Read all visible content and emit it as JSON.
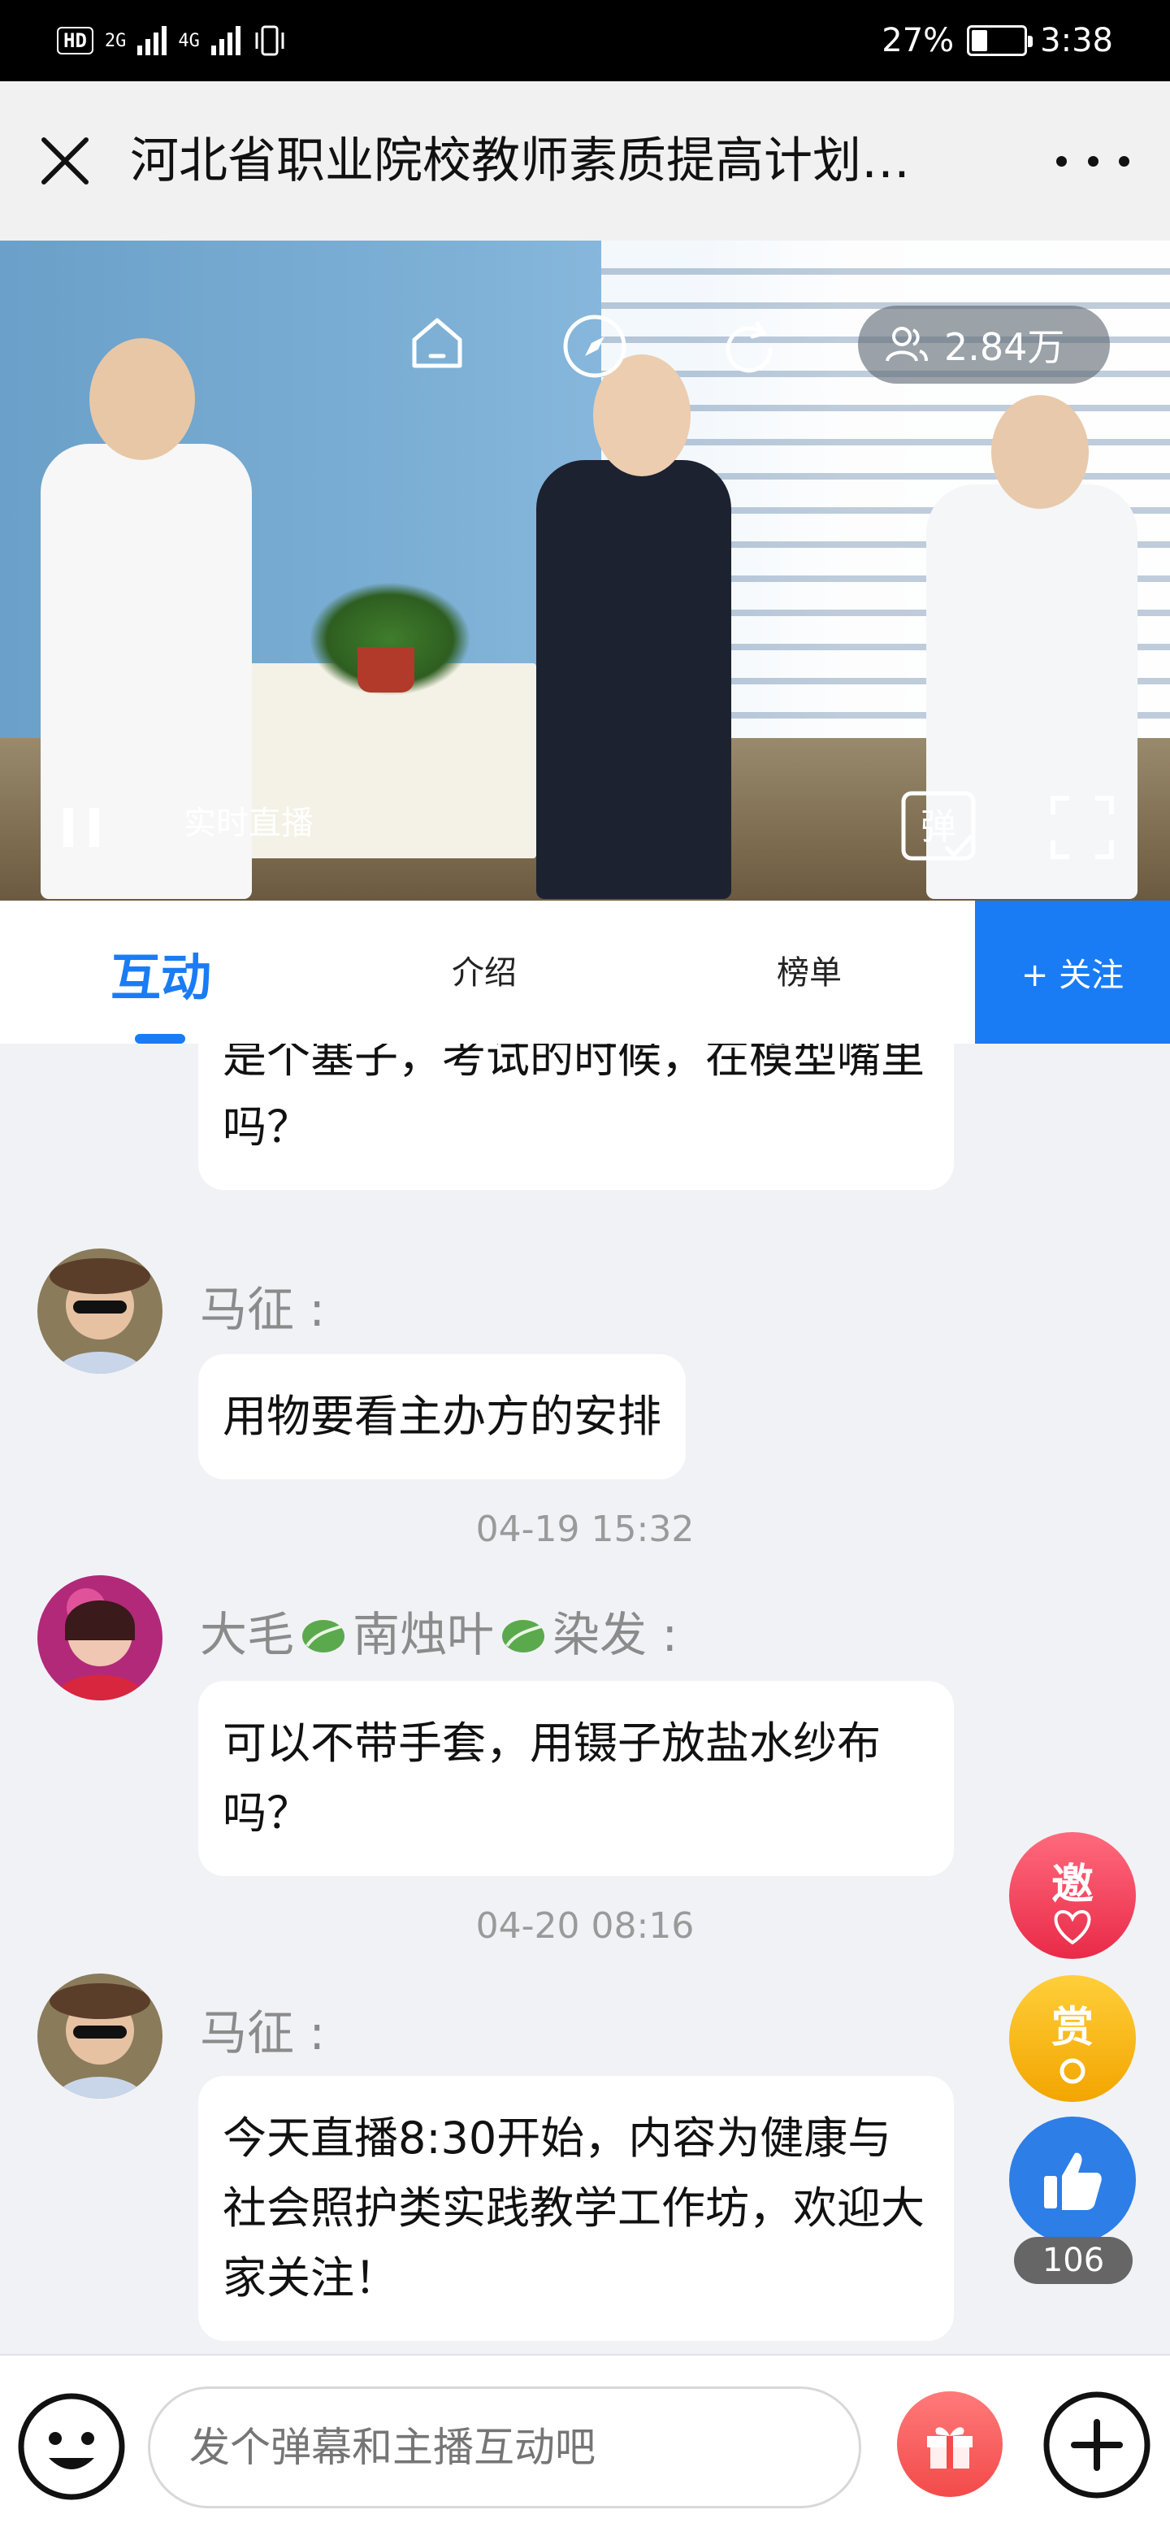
{
  "status_bar": {
    "hd": "HD",
    "net1": "2G",
    "net2": "4G",
    "battery_percent": "27%",
    "battery_level": 0.27,
    "time": "3:38"
  },
  "header": {
    "title": "河北省职业院校教师素质提高计划…",
    "close_icon": "close-icon",
    "more_icon": "more-icon"
  },
  "video": {
    "viewer_count": "2.84万",
    "live_label": "实时直播",
    "danmu_label": "弹",
    "icons": [
      "home-icon",
      "compass-icon",
      "refresh-icon",
      "viewers-icon",
      "pause-icon",
      "danmu-icon",
      "fullscreen-icon"
    ]
  },
  "tabs": {
    "interact": "互动",
    "intro": "介绍",
    "rank": "榜单",
    "follow": "+ 关注",
    "accent": "#1a7cf5"
  },
  "chat": {
    "messages": [
      {
        "text": "是个塞子，考试的时候，在模型嘴里吗？"
      },
      {
        "name": "马征 :",
        "text": "用物要看主办方的安排"
      },
      {
        "time": "04-19 15:32"
      },
      {
        "name_parts": [
          "大毛",
          "南烛叶",
          "染发 :"
        ],
        "text": "可以不带手套，用镊子放盐水纱布吗？"
      },
      {
        "time": "04-20 08:16"
      },
      {
        "name": "马征 :",
        "text": "今天直播8:30开始，内容为健康与社会照护类实践教学工作坊，欢迎大家关注！"
      }
    ]
  },
  "floating": {
    "invite": "邀",
    "reward": "赏",
    "like_count": "106"
  },
  "bottom": {
    "input_placeholder": "发个弹幕和主播互动吧"
  },
  "colors": {
    "accent": "#1a7cf5",
    "invite": "#e92a49",
    "reward": "#f2a500",
    "like": "#2d7ee6"
  }
}
